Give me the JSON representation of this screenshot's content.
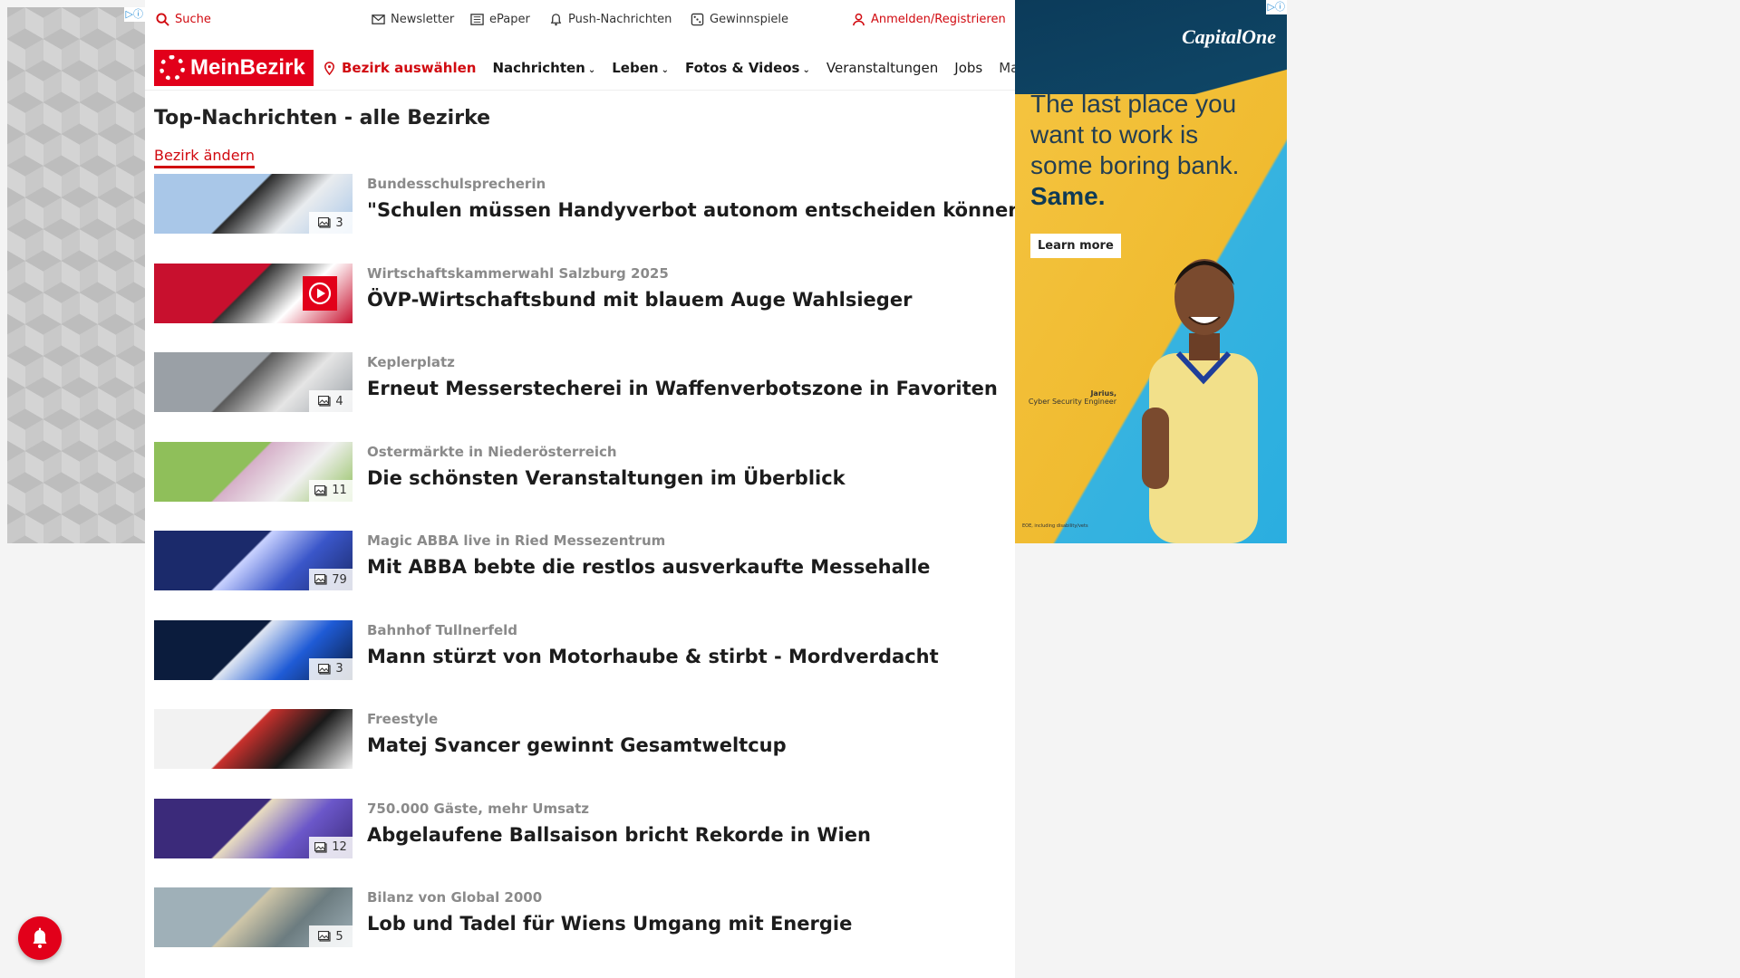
{
  "ads": {
    "adchoice_glyph": "▷ⓘ",
    "right": {
      "brand": "CapitalOne",
      "headline": "The last place you want to work is some boring bank.",
      "headline_strong": "Same.",
      "cta": "Learn more",
      "person_name": "Jarius,",
      "person_title": "Cyber Security Engineer",
      "fine_print": "EOE, including disability/vets"
    }
  },
  "topbar": {
    "search": "Suche",
    "newsletter": "Newsletter",
    "epaper": "ePaper",
    "push": "Push-Nachrichten",
    "games": "Gewinnspiele",
    "login": "Anmelden/Registrieren"
  },
  "nav": {
    "logo": "MeinBezirk",
    "select_district": "Bezirk auswählen",
    "items": [
      "Nachrichten",
      "Leben",
      "Fotos & Videos",
      "Veranstaltungen",
      "Jobs",
      "Marktplatz"
    ]
  },
  "section": {
    "title": "Top-Nachrichten - alle Bezirke",
    "change_district": "Bezirk ändern"
  },
  "articles": [
    {
      "kicker": "Bundesschulsprecherin",
      "headline": "\"Schulen müssen Handyverbot autonom entscheiden können\"",
      "photos": "3",
      "media": "gallery",
      "colors": [
        "#a9c7e8",
        "#e9ecef",
        "#2a2a2a"
      ]
    },
    {
      "kicker": "Wirtschaftskammerwahl Salzburg 2025",
      "headline": "ÖVP-Wirtschaftsbund mit blauem Auge Wahlsieger",
      "photos": "",
      "media": "video",
      "colors": [
        "#c8102e",
        "#ffffff",
        "#333333"
      ]
    },
    {
      "kicker": "Keplerplatz",
      "headline": "Erneut Messerstecherei in Waffenverbotszone in Favoriten",
      "photos": "4",
      "media": "gallery",
      "colors": [
        "#9aa0a6",
        "#e5e5e5",
        "#5a5a5a"
      ]
    },
    {
      "kicker": "Ostermärkte in Niederösterreich",
      "headline": "Die schönsten Veranstaltungen im Überblick",
      "photos": "11",
      "media": "gallery",
      "colors": [
        "#8fbf5a",
        "#f0f0f0",
        "#d6b0c9"
      ]
    },
    {
      "kicker": "Magic ABBA live in Ried Messezentrum",
      "headline": "Mit ABBA bebte die restlos ausverkaufte Messehalle",
      "photos": "79",
      "media": "gallery",
      "colors": [
        "#1b2a6b",
        "#3a56c9",
        "#c9d2ff"
      ]
    },
    {
      "kicker": "Bahnhof Tullnerfeld",
      "headline": "Mann stürzt von Motorhaube & stirbt - Mordverdacht",
      "photos": "3",
      "media": "gallery",
      "colors": [
        "#0b1c3d",
        "#1f5bd6",
        "#dfe6f2"
      ]
    },
    {
      "kicker": "Freestyle",
      "headline": "Matej Svancer gewinnt Gesamtweltcup",
      "photos": "",
      "media": "none",
      "colors": [
        "#f2f2f2",
        "#1a1a1a",
        "#c9302c"
      ]
    },
    {
      "kicker": "750.000 Gäste, mehr Umsatz",
      "headline": "Abgelaufene Ballsaison bricht Rekorde in Wien",
      "photos": "12",
      "media": "gallery",
      "colors": [
        "#3b2a7a",
        "#6b57c9",
        "#e8dcc0"
      ]
    },
    {
      "kicker": "Bilanz von Global 2000",
      "headline": "Lob und Tadel für Wiens Umgang mit Energie",
      "photos": "5",
      "media": "gallery",
      "colors": [
        "#9fb0b8",
        "#6c7c80",
        "#cfc6a8"
      ]
    }
  ]
}
